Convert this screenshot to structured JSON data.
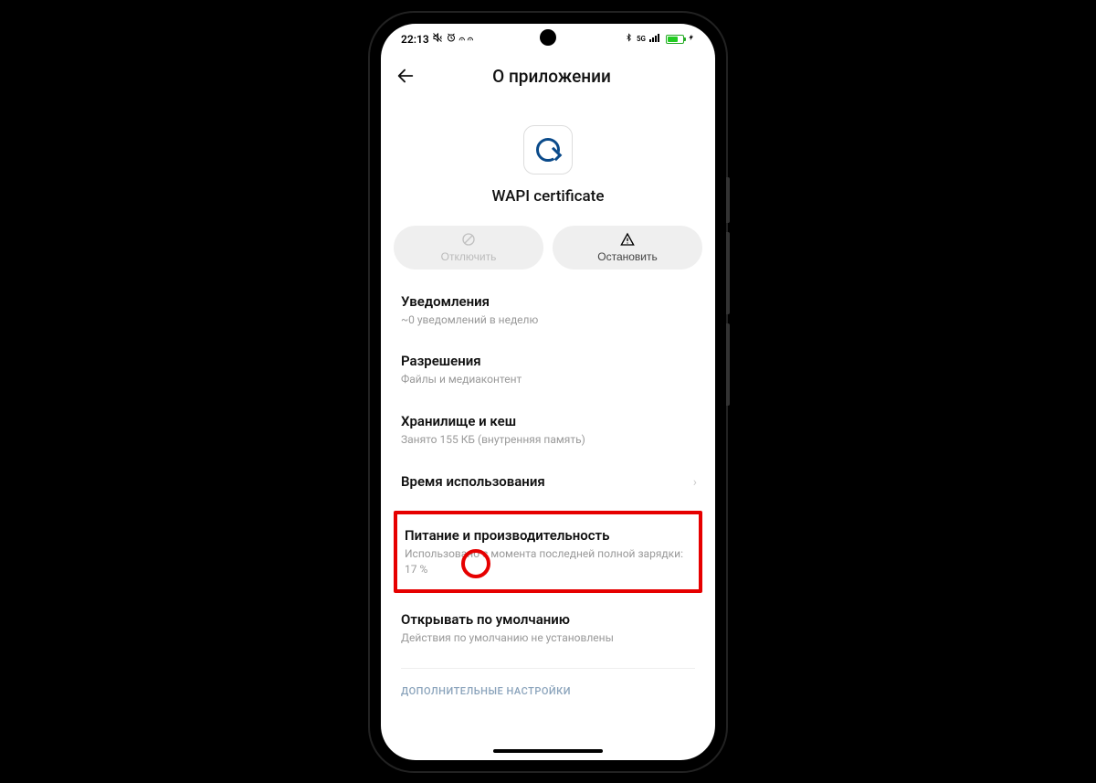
{
  "status": {
    "time": "22:13",
    "icons_left": [
      "mute-icon",
      "alarm-icon",
      "vv-icon",
      "vv2-icon"
    ],
    "icons_right": [
      "bt-icon",
      "signal-icon",
      "bars-icon",
      "battery-icon",
      "bolt-icon"
    ]
  },
  "header": {
    "title": "О приложении"
  },
  "app": {
    "name": "WAPI certificate"
  },
  "actions": {
    "disable": {
      "label": "Отключить"
    },
    "stop": {
      "label": "Остановить"
    }
  },
  "items": [
    {
      "title": "Уведомления",
      "sub": "~0 уведомлений в неделю"
    },
    {
      "title": "Разрешения",
      "sub": "Файлы и медиаконтент"
    },
    {
      "title": "Хранилище и кеш",
      "sub": "Занято 155 КБ (внутренняя память)"
    },
    {
      "title": "Время использования",
      "sub": ""
    },
    {
      "title": "Питание и производительность",
      "sub": "Использовано с момента последней полной зарядки: 17 %"
    },
    {
      "title": "Открывать по умолчанию",
      "sub": "Действия по умолчанию не установлены"
    }
  ],
  "section_label": "ДОПОЛНИТЕЛЬНЫЕ НАСТРОЙКИ",
  "annotations": {
    "highlighted_item_index": 4,
    "circled_value": "17 %"
  }
}
